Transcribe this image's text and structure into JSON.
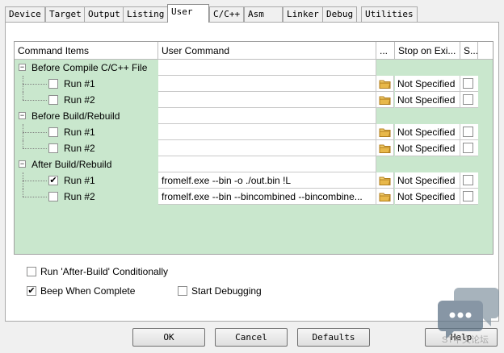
{
  "tabs": [
    "Device",
    "Target",
    "Output",
    "Listing",
    "User",
    "C/C++",
    "Asm",
    "Linker",
    "Debug",
    "Utilities"
  ],
  "grid": {
    "headers": [
      "Command Items",
      "User Command",
      "...",
      "Stop on Exi...",
      "S..."
    ],
    "groups": [
      {
        "label": "Before Compile C/C++ File",
        "items": [
          {
            "label": "Run #1",
            "checked": false,
            "command": "",
            "stop": "Not Specified"
          },
          {
            "label": "Run #2",
            "checked": false,
            "command": "",
            "stop": "Not Specified"
          }
        ]
      },
      {
        "label": "Before Build/Rebuild",
        "items": [
          {
            "label": "Run #1",
            "checked": false,
            "command": "",
            "stop": "Not Specified"
          },
          {
            "label": "Run #2",
            "checked": false,
            "command": "",
            "stop": "Not Specified"
          }
        ]
      },
      {
        "label": "After Build/Rebuild",
        "items": [
          {
            "label": "Run #1",
            "checked": true,
            "command": "fromelf.exe --bin -o ./out.bin !L",
            "stop": "Not Specified"
          },
          {
            "label": "Run #2",
            "checked": false,
            "command": "fromelf.exe --bin --bincombined --bincombine...",
            "stop": "Not Specified"
          }
        ]
      }
    ],
    "expander_symbol": "−",
    "check_symbol": "✔"
  },
  "options": {
    "run_after_build": {
      "label": "Run 'After-Build' Conditionally",
      "checked": false
    },
    "beep": {
      "label": "Beep When Complete",
      "checked": true
    },
    "start_debugging": {
      "label": "Start Debugging",
      "checked": false
    }
  },
  "buttons": {
    "ok": "OK",
    "cancel": "Cancel",
    "defaults": "Defaults",
    "help": "Help"
  },
  "watermark": {
    "text": "ST中文论坛"
  },
  "colors": {
    "grid_bg": "#c9e7cd",
    "folder": "#e8b84a"
  }
}
